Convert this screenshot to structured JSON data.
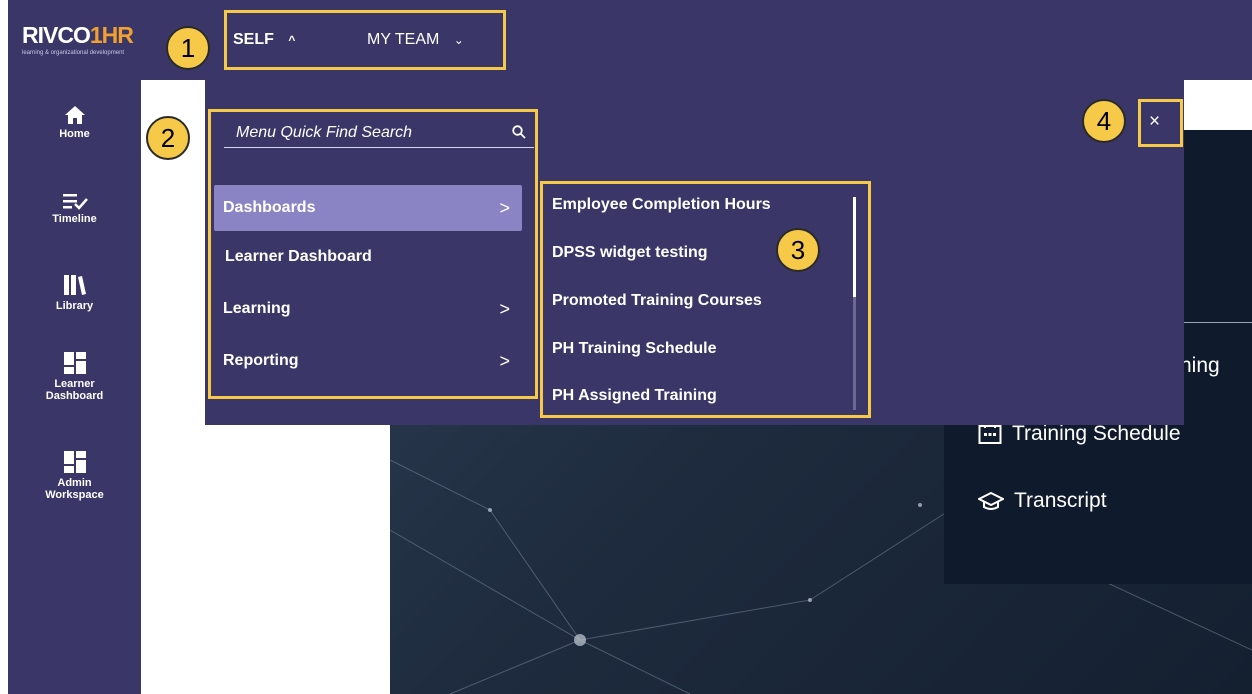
{
  "brand": {
    "logo_main": "RIVCO",
    "logo_hr": "1HR",
    "logo_sub": "learning & organizational development"
  },
  "topnav": {
    "self_label": "SELF",
    "self_chevron": "^",
    "team_label": "MY TEAM",
    "team_chevron": "⌄"
  },
  "sidebar": {
    "items": [
      {
        "label": "Home",
        "icon": "home-icon"
      },
      {
        "label": "Timeline",
        "icon": "timeline-icon"
      },
      {
        "label": "Library",
        "icon": "library-icon"
      },
      {
        "label": "Learner Dashboard",
        "icon": "dashboard-icon"
      },
      {
        "label": "Admin Workspace",
        "icon": "dashboard-icon"
      }
    ]
  },
  "search": {
    "placeholder": "Menu Quick Find Search",
    "icon": "search-icon"
  },
  "menu": {
    "items": [
      {
        "label": "Dashboards",
        "arrow": ">"
      },
      {
        "label": "Learner Dashboard"
      },
      {
        "label": "Learning",
        "arrow": ">"
      },
      {
        "label": "Reporting",
        "arrow": ">"
      }
    ]
  },
  "submenu": {
    "items": [
      "Employee Completion Hours",
      "DPSS widget testing",
      "Promoted Training Courses",
      "PH Training Schedule",
      "PH Assigned Training"
    ]
  },
  "close": {
    "label": "×"
  },
  "right_panel": {
    "items": [
      {
        "label": "ning"
      },
      {
        "label": "Training Schedule",
        "icon": "calendar-icon"
      },
      {
        "label": "Transcript",
        "icon": "graduation-cap-icon"
      }
    ]
  },
  "callouts": [
    "1",
    "2",
    "3",
    "4"
  ],
  "colors": {
    "nav_bg": "#3a3768",
    "active_item": "#8b84c4",
    "highlight": "#f7c948",
    "panel_bg": "#0f1b2c"
  }
}
